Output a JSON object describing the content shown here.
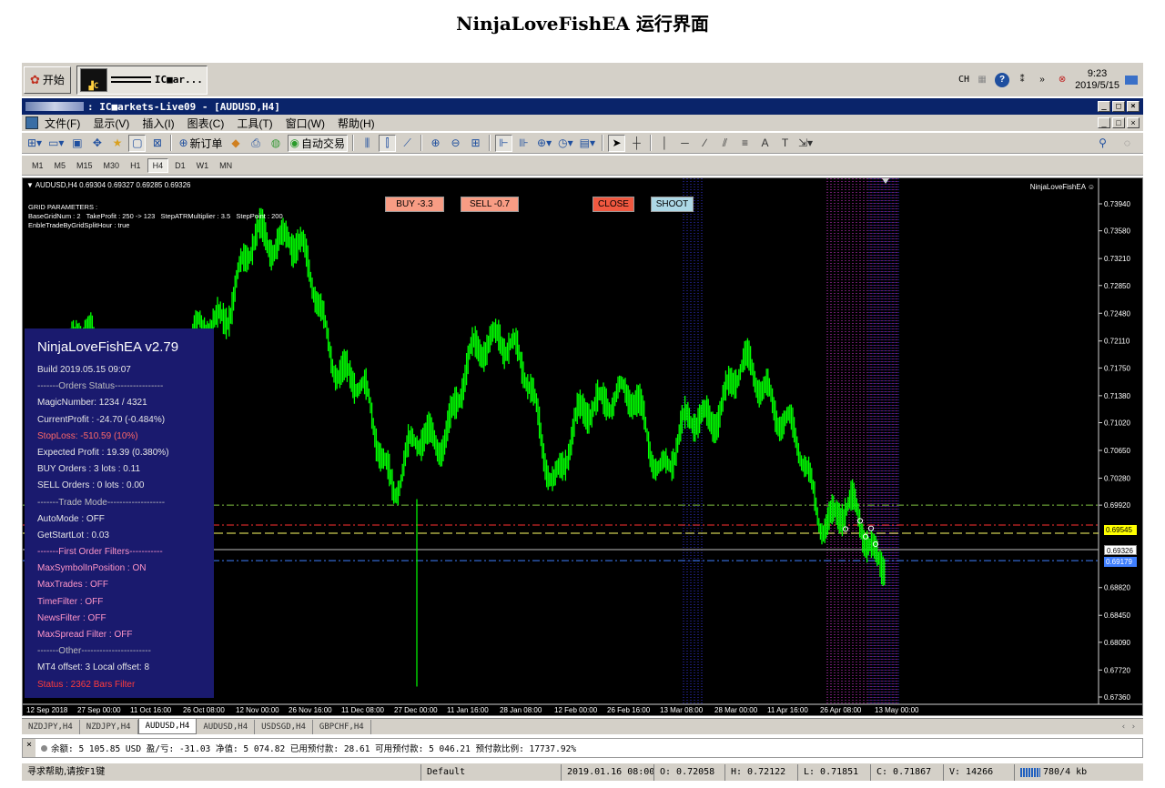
{
  "page_title": "NinjaLoveFishEA 运行界面",
  "taskbar": {
    "start_label": "开始",
    "task_label": "IC■ar...",
    "lang": "CH",
    "clock_time": "9:23",
    "clock_date": "2019/5/15"
  },
  "window": {
    "title": ": IC■arkets-Live09 - [AUDUSD,H4]",
    "controls": [
      "_",
      "□",
      "×"
    ]
  },
  "menu": [
    "文件(F)",
    "显示(V)",
    "插入(I)",
    "图表(C)",
    "工具(T)",
    "窗口(W)",
    "帮助(H)"
  ],
  "toolbar": {
    "new_order": "新订单",
    "auto_trade": "自动交易",
    "text_tool": "A"
  },
  "timeframes": [
    "M1",
    "M5",
    "M15",
    "M30",
    "H1",
    "H4",
    "D1",
    "W1",
    "MN"
  ],
  "active_timeframe": "H4",
  "chart": {
    "header": "AUDUSD,H4  0.69304 0.69327 0.69285 0.69326",
    "ea_label": "NinjaLoveFishEA ☺",
    "grid_params": "GRID PARAMETERS :\nBaseGridNum : 2   TakeProfit : 250 -> 123   StepATRMultiplier : 3.5   StepPoint : 200\nEnbleTradeByGridSplitHour : true",
    "buttons": {
      "buy": "BUY -3.3",
      "sell": "SELL -0.7",
      "close": "CLOSE",
      "shoot": "SHOOT"
    },
    "price_labels": [
      "0.73940",
      "0.73580",
      "0.73210",
      "0.72850",
      "0.72480",
      "0.72110",
      "0.71750",
      "0.71380",
      "0.71020",
      "0.70650",
      "0.70280",
      "0.69920",
      "0.69545",
      "0.69326",
      "0.69179",
      "0.68820",
      "0.68450",
      "0.68090",
      "0.67720",
      "0.67360"
    ],
    "tagged_prices": {
      "red_line": "0.69545",
      "bid": "0.69326",
      "blue_line": "0.69179"
    },
    "time_labels": [
      "12 Sep 2018",
      "27 Sep 00:00",
      "11 Oct 16:00",
      "26 Oct 08:00",
      "12 Nov 00:00",
      "26 Nov 16:00",
      "11 Dec 08:00",
      "27 Dec 00:00",
      "11 Jan 16:00",
      "28 Jan 08:00",
      "12 Feb 00:00",
      "26 Feb 16:00",
      "13 Mar 08:00",
      "28 Mar 00:00",
      "11 Apr 16:00",
      "26 Apr 08:00",
      "13 May 00:00"
    ],
    "colors": {
      "background": "#000000",
      "price": "#00ff00",
      "line_green": "#7fbf3f",
      "line_red": "#ff3030",
      "line_yellow": "#ffff66",
      "line_blue": "#3f7fff",
      "line_silver": "#c0c0c0"
    }
  },
  "chart_data": {
    "type": "line",
    "title": "AUDUSD,H4",
    "ylim": [
      0.6736,
      0.7394
    ],
    "x": [
      "12 Sep 2018",
      "27 Sep 00:00",
      "11 Oct 16:00",
      "26 Oct 08:00",
      "12 Nov 00:00",
      "26 Nov 16:00",
      "11 Dec 08:00",
      "27 Dec 00:00",
      "11 Jan 16:00",
      "28 Jan 08:00",
      "12 Feb 00:00",
      "26 Feb 16:00",
      "13 Mar 08:00",
      "28 Mar 00:00",
      "11 Apr 16:00",
      "26 Apr 08:00",
      "13 May 00:00"
    ],
    "series": [
      {
        "values": [
          0.712,
          0.724,
          0.709,
          0.7185,
          0.729,
          0.7365,
          0.719,
          0.702,
          0.712,
          0.723,
          0.705,
          0.715,
          0.706,
          0.713,
          0.716,
          0.7,
          0.693
        ]
      }
    ],
    "hlines": [
      {
        "price": 0.6992,
        "color": "green"
      },
      {
        "price": 0.69655,
        "color": "red"
      },
      {
        "price": 0.69545,
        "color": "yellow"
      },
      {
        "price": 0.69326,
        "color": "silver"
      },
      {
        "price": 0.69179,
        "color": "blue"
      }
    ],
    "spike_low": {
      "at": "27 Dec 00:00",
      "low": 0.675
    }
  },
  "panel": {
    "title": "NinjaLoveFishEA v2.79",
    "lines": [
      {
        "t": "Build 2019.05.15 09:07",
        "c": ""
      },
      {
        "t": "-------Orders Status----------------",
        "c": "c-sep"
      },
      {
        "t": "MagicNumber: 1234 / 4321",
        "c": ""
      },
      {
        "t": "CurrentProfit : -24.70 (-0.484%)",
        "c": ""
      },
      {
        "t": "StopLoss: -510.59 (10%)",
        "c": "c-red"
      },
      {
        "t": "Expected Profit : 19.39 (0.380%)",
        "c": ""
      },
      {
        "t": "BUY Orders : 3     lots : 0.11",
        "c": ""
      },
      {
        "t": "SELL Orders : 0     lots : 0.00",
        "c": ""
      },
      {
        "t": "-------Trade Mode-------------------",
        "c": "c-sep"
      },
      {
        "t": "AutoMode : OFF",
        "c": ""
      },
      {
        "t": "GetStartLot : 0.03",
        "c": ""
      },
      {
        "t": "-------First Order Filters-----------",
        "c": "c-pink"
      },
      {
        "t": "MaxSymbolInPosition : ON",
        "c": "c-pink"
      },
      {
        "t": "MaxTrades : OFF",
        "c": "c-pink"
      },
      {
        "t": "TimeFilter : OFF",
        "c": "c-pink"
      },
      {
        "t": "NewsFilter : OFF",
        "c": "c-pink"
      },
      {
        "t": "MaxSpread Filter : OFF",
        "c": "c-pink"
      },
      {
        "t": "-------Other-----------------------",
        "c": "c-sep"
      },
      {
        "t": "MT4 offset: 3     Local offset: 8",
        "c": ""
      },
      {
        "t": "Status : 2362 Bars Filter",
        "c": "c-redbright"
      }
    ]
  },
  "tabs": [
    "NZDJPY,H4",
    "NZDJPY,H4",
    "AUDUSD,H4",
    "AUDUSD,H4",
    "USDSGD,H4",
    "GBPCHF,H4"
  ],
  "active_tab": 2,
  "account": "余额: 5 105.85 USD  盈/亏: -31.03  净值: 5 074.82  已用预付款: 28.61  可用预付款: 5 046.21  预付款比例: 17737.92%",
  "status": {
    "help": "寻求帮助,请按F1键",
    "profile": "Default",
    "time": "2019.01.16 08:00",
    "open": "O: 0.72058",
    "high": "H: 0.72122",
    "low": "L: 0.71851",
    "close": "C: 0.71867",
    "volume": "V: 14266",
    "traffic": "780/4 kb"
  }
}
